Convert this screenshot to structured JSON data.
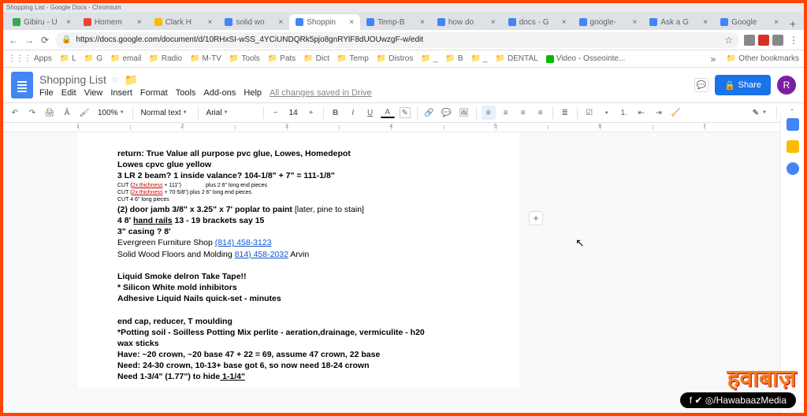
{
  "window_title": "Shopping List - Google Docs - Chromium",
  "tabs": [
    {
      "label": "Gibiru - U",
      "favicon": "#34a853"
    },
    {
      "label": "Homem",
      "favicon": "#ea4335"
    },
    {
      "label": "Clark H",
      "favicon": "#fbbc04"
    },
    {
      "label": "solid wo",
      "favicon": "#4285f4"
    },
    {
      "label": "Shoppin",
      "favicon": "#4285f4"
    },
    {
      "label": "Temp-B",
      "favicon": "#4285f4"
    },
    {
      "label": "how do",
      "favicon": "#4285f4"
    },
    {
      "label": "docs - G",
      "favicon": "#4285f4"
    },
    {
      "label": "google-",
      "favicon": "#4285f4"
    },
    {
      "label": "Ask a G",
      "favicon": "#4285f4"
    },
    {
      "label": "Google",
      "favicon": "#4285f4"
    }
  ],
  "active_tab_index": 4,
  "omnibox": {
    "url": "https://docs.google.com/document/d/10RHxSI-wSS_4YCiUNDQRk5pjo8gnRYlF8dUOUwzgF-w/edit"
  },
  "bookmarks": {
    "apps": "Apps",
    "items": [
      "L",
      "G",
      "email",
      "Radio",
      "M-TV",
      "Tools",
      "Pats",
      "Dict",
      "Temp",
      "Distros",
      "_",
      "B",
      "_",
      "DENTAL"
    ],
    "video": "Video - Osseointe...",
    "other": "Other bookmarks"
  },
  "doc": {
    "title": "Shopping List",
    "menu": [
      "File",
      "Edit",
      "View",
      "Insert",
      "Format",
      "Tools",
      "Add-ons",
      "Help"
    ],
    "saved": "All changes saved in Drive"
  },
  "share": {
    "label": "Share",
    "avatar_initial": "R"
  },
  "toolbar": {
    "zoom": "100%",
    "style": "Normal text",
    "font": "Arial",
    "size": "14"
  },
  "ruler_nums": [
    "1",
    "",
    "2",
    "",
    "3",
    "",
    "4",
    "",
    "5",
    "",
    "6",
    "",
    "7"
  ],
  "content": {
    "l1a": "return: True Value all purpose pvc glue, Lowes, Homedepot",
    "l1b": "Lowes cpvc glue yellow",
    "l2": "3 LR 2 beam? 1 inside valance? 104-1/8\" + 7\" = 111-1/8\"",
    "l3a": "CUT (",
    "l3b": "2x thichness",
    "l3c": " + 111\")",
    "l3d": "plus 2 6\" long end pieces",
    "l4a": "CUT (",
    "l4b": "2x thichness",
    "l4c": " + 70-5/8\")  plus 2 6\" long end pieces",
    "l5": "CUT 4 6\" long pieces",
    "l6a": "(2) door jamb 3/8\" x 3.25\" x 7' poplar to paint",
    "l6b": "  [later, pine to stain]",
    "l7a": "4 8' ",
    "l7b": "hand rails",
    "l7c": " 13 - 19 brackets say 15",
    "l8": "3\" casing ? 8'",
    "l9a": "Evergreen Furniture Shop ",
    "l9b": "(814) 458-3123",
    "l10a": "Solid Wood Floors and Molding ",
    "l10b": "814) 458-2032",
    "l10c": "     Arvin",
    "l11": "Liquid Smoke    delron       Take Tape!!",
    "l12": "* Silicon White mold inhibitors",
    "l13": "Adhesive Liquid Nails quick-set - minutes",
    "l14": "end cap, reducer, T moulding",
    "l15": "*Potting soil - Soilless Potting Mix perlite - aeration,drainage, vermiculite - h20",
    "l16": "wax sticks",
    "l17a": "Have:",
    "l17b": "       ~20 crown, ~20 base 47 + 22 = 69, assume 47 crown, 22 base",
    "l18a": "Need:",
    "l18b": "       24-30 crown, 10-13+ base got 6, so now need 18-24 crown",
    "l19a": "Need 1-3/4\" (1.77\") to hide",
    "l19b": " 1-1/4\""
  },
  "watermark": {
    "brand": "हवाबाज़",
    "handle": "/HawabaazMedia"
  }
}
